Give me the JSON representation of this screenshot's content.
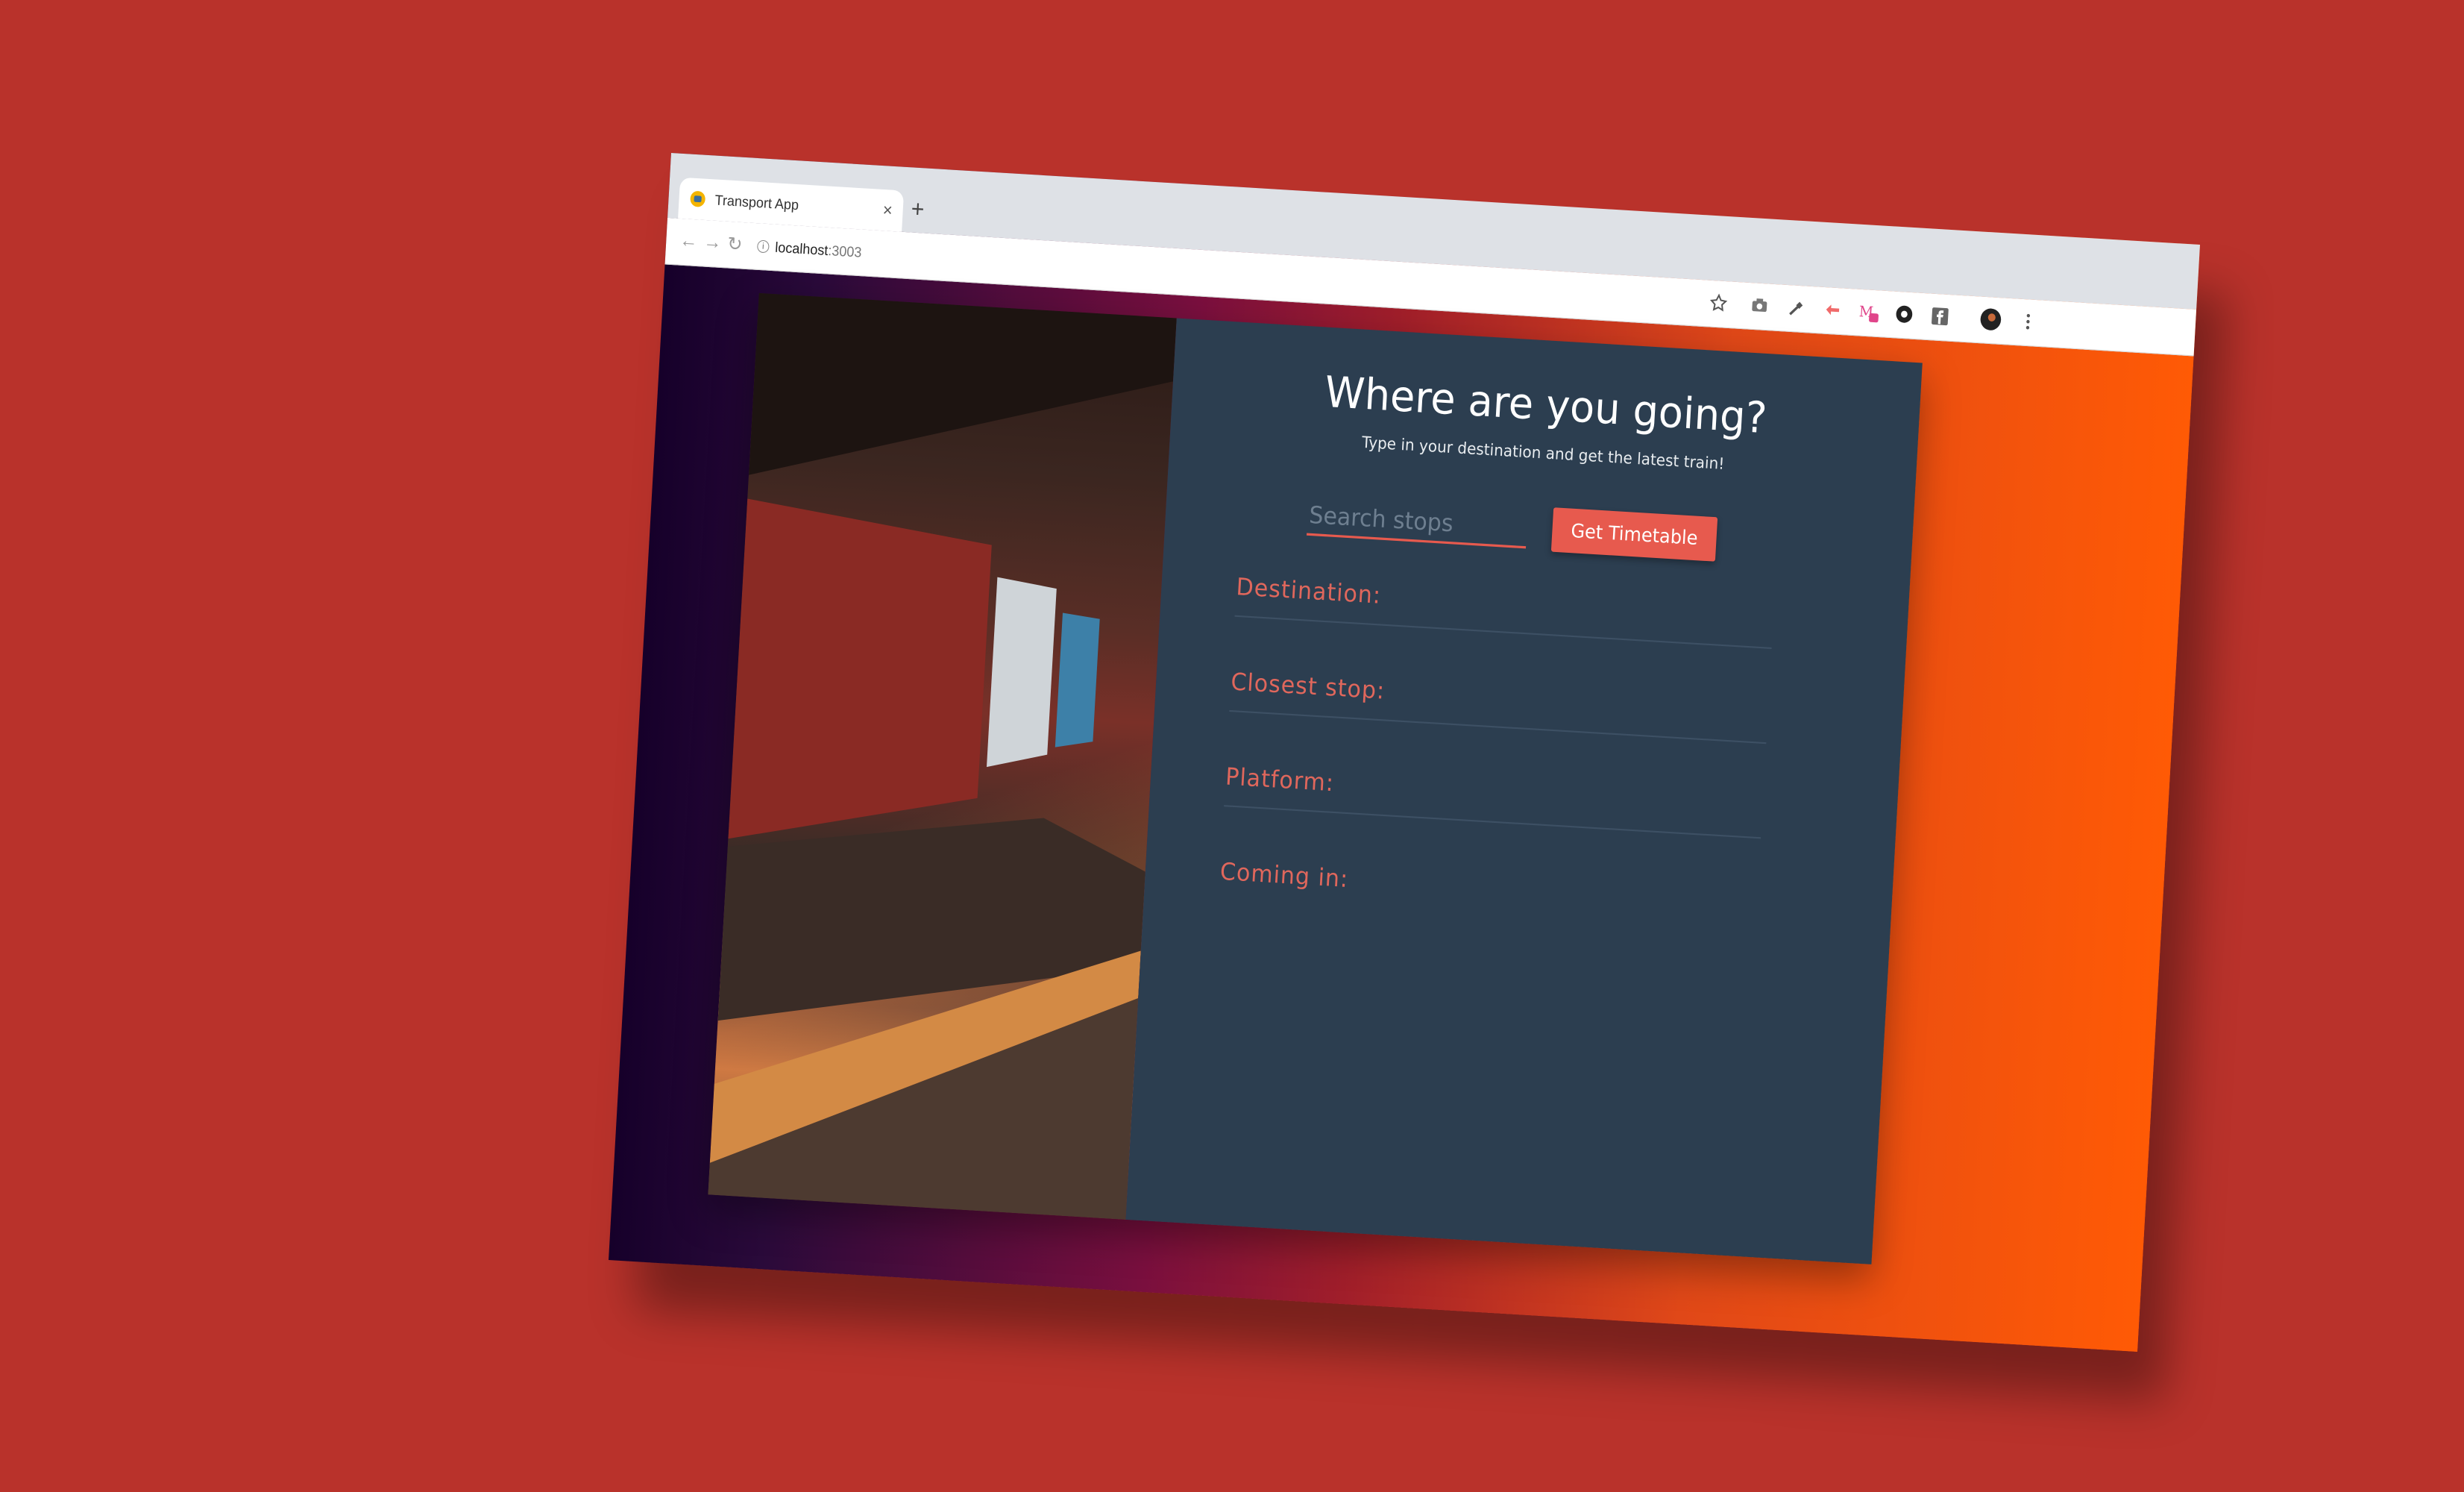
{
  "browser": {
    "tab_title": "Transport App",
    "tab_close": "×",
    "new_tab": "+",
    "url_host": "localhost",
    "url_port": ":3003"
  },
  "app": {
    "heading": "Where are you going?",
    "subheading": "Type in your destination and get the latest train!",
    "search_placeholder": "Search stops",
    "search_value": "",
    "button_label": "Get Timetable",
    "fields": [
      {
        "label": "Destination:",
        "value": ""
      },
      {
        "label": "Closest stop:",
        "value": ""
      },
      {
        "label": "Platform:",
        "value": ""
      },
      {
        "label": "Coming in:",
        "value": ""
      }
    ]
  },
  "colors": {
    "background": "#b9322b",
    "panel": "#2c3e50",
    "accent": "#e75a4e",
    "label": "#e0675c"
  }
}
